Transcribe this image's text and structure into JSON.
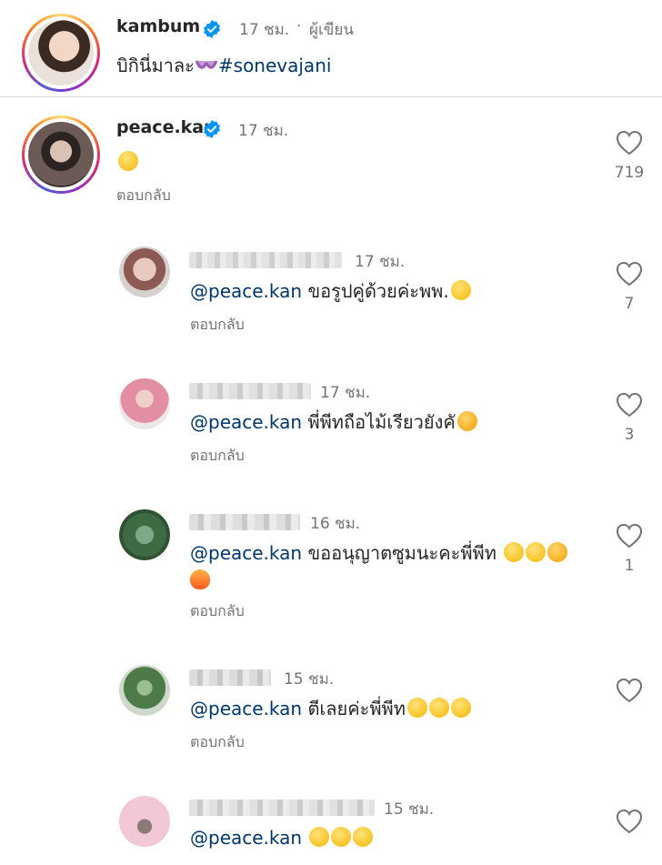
{
  "post": {
    "username": "kambum",
    "time": "17 ชม.",
    "separator": "·",
    "author_badge": "ผู้เขียน",
    "caption_text": "บิกินี่มาละ",
    "hashtag": "#sonevajani"
  },
  "reply": {
    "username": "peace.kan",
    "time": "17 ชม.",
    "likes": "719",
    "reply_label": "ตอบกลับ"
  },
  "comments": [
    {
      "time": "17 ชม.",
      "mention": "@peace.kan",
      "text": "ขอรูปคู่ด้วยค่ะพพ.",
      "likes": "7",
      "reply_label": "ตอบกลับ"
    },
    {
      "time": "17 ชม.",
      "mention": "@peace.kan",
      "text": "พี่พีทถือไม้เรียวยังคั",
      "likes": "3",
      "reply_label": "ตอบกลับ"
    },
    {
      "time": "16 ชม.",
      "mention": "@peace.kan",
      "text": "ขออนุญาตซูมนะคะพี่พีท",
      "likes": "1",
      "reply_label": "ตอบกลับ"
    },
    {
      "time": "15 ชม.",
      "mention": "@peace.kan",
      "text": "ตีเลยค่ะพี่พีท",
      "likes": "",
      "reply_label": "ตอบกลับ"
    },
    {
      "time": "15 ชม.",
      "mention": "@peace.kan",
      "text": "",
      "likes": "",
      "reply_label": ""
    }
  ],
  "colors": {
    "link": "#00376b",
    "muted": "#737373",
    "verified": "#0095f6"
  }
}
